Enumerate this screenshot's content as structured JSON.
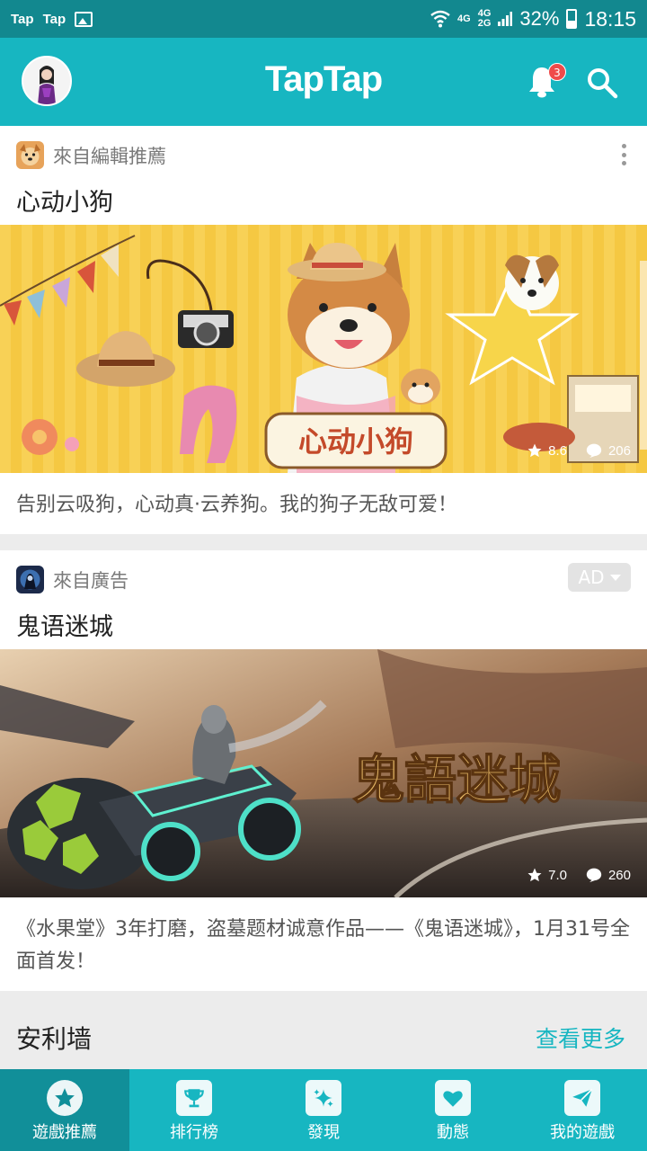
{
  "status_bar": {
    "left_apps": [
      "Tap",
      "Tap"
    ],
    "network": [
      "4G",
      "4G",
      "2G"
    ],
    "battery": "32%",
    "time": "18:15"
  },
  "header": {
    "logo": "TapTap",
    "notification_count": "3",
    "icons": [
      "avatar",
      "bell-icon",
      "search-icon"
    ]
  },
  "cards": [
    {
      "source": "來自編輯推薦",
      "title": "心动小狗",
      "banner_text": "心动小狗",
      "rating": "8.6",
      "comments": "206",
      "description": "告别云吸狗，心动真·云养狗。我的狗子无敌可爱！"
    },
    {
      "source": "來自廣告",
      "title": "鬼语迷城",
      "ad_label": "AD",
      "banner_text": "鬼語迷城",
      "rating": "7.0",
      "comments": "260",
      "description": "《水果堂》3年打磨，盗墓题材诚意作品——《鬼语迷城》，1月31号全面首发！"
    }
  ],
  "section": {
    "title": "安利墙",
    "more": "查看更多"
  },
  "bottom_nav": [
    {
      "label": "遊戲推薦",
      "icon": "star-icon",
      "active": true
    },
    {
      "label": "排行榜",
      "icon": "trophy-icon",
      "active": false
    },
    {
      "label": "發現",
      "icon": "sparkle-icon",
      "active": false
    },
    {
      "label": "動態",
      "icon": "heart-icon",
      "active": false
    },
    {
      "label": "我的遊戲",
      "icon": "send-icon",
      "active": false
    }
  ],
  "colors": {
    "accent": "#17b6c1",
    "status_bar": "#12888f",
    "badge": "#ef4a4a"
  }
}
